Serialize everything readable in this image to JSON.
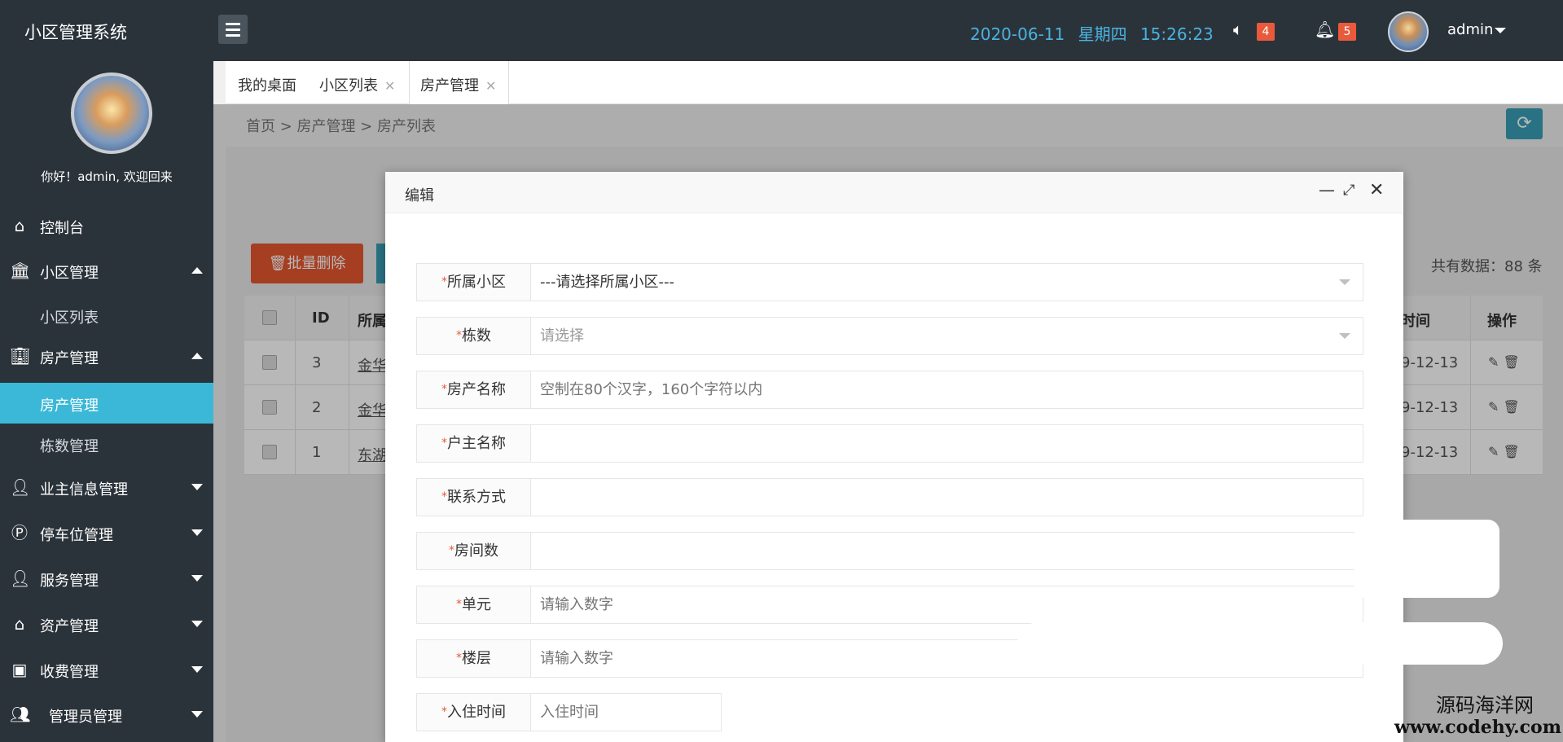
{
  "header": {
    "brand": "小区管理系统",
    "date": "2020-06-11",
    "weekday": "星期四",
    "time": "15:26:23",
    "sound_badge": "4",
    "bell_badge": "5",
    "user": "admin"
  },
  "sidebar": {
    "welcome": "你好！admin, 欢迎回来",
    "items": [
      {
        "label": "控制台"
      },
      {
        "label": "小区管理"
      },
      {
        "label": "小区列表"
      },
      {
        "label": "房产管理"
      },
      {
        "label": "房产管理"
      },
      {
        "label": "栋数管理"
      },
      {
        "label": "业主信息管理"
      },
      {
        "label": "停车位管理"
      },
      {
        "label": "服务管理"
      },
      {
        "label": "资产管理"
      },
      {
        "label": "收费管理"
      },
      {
        "label": "管理员管理"
      }
    ]
  },
  "tabs": [
    {
      "label": "我的桌面"
    },
    {
      "label": "小区列表"
    },
    {
      "label": "房产管理"
    }
  ],
  "breadcrumb": "首页  >  房产管理  >  房产列表",
  "toolbar": {
    "batch_delete": "批量删除",
    "total": "共有数据：88 条"
  },
  "table": {
    "headers": {
      "id": "ID",
      "community": "所属",
      "time": "时间",
      "ops": "操作"
    },
    "rows": [
      {
        "id": "3",
        "community": "金华",
        "date": "9-12-13"
      },
      {
        "id": "2",
        "community": "金华",
        "date": "9-12-13"
      },
      {
        "id": "1",
        "community": "东湖",
        "date": "9-12-13"
      }
    ]
  },
  "dialog": {
    "title": "编辑",
    "fields": [
      {
        "label": "所属小区",
        "value": "---请选择所属小区---",
        "placeholder": ""
      },
      {
        "label": "栋数",
        "value": "",
        "placeholder": "请选择"
      },
      {
        "label": "房产名称",
        "value": "",
        "placeholder": "空制在80个汉字，160个字符以内"
      },
      {
        "label": "户主名称",
        "value": "",
        "placeholder": ""
      },
      {
        "label": "联系方式",
        "value": "",
        "placeholder": ""
      },
      {
        "label": "房间数",
        "value": "",
        "placeholder": ""
      },
      {
        "label": "单元",
        "value": "",
        "placeholder": "请输入数字"
      },
      {
        "label": "楼层",
        "value": "",
        "placeholder": "请输入数字"
      },
      {
        "label": "入住时间",
        "value": "",
        "placeholder": "入住时间"
      }
    ]
  },
  "watermark": {
    "cn": "源码海洋网",
    "en": "www.codehy.com"
  },
  "colors": {
    "sidebar_bg": "#2b333a",
    "active_item": "#3bb8d8",
    "danger": "#e6572f",
    "datetime": "#4ab2e0"
  }
}
